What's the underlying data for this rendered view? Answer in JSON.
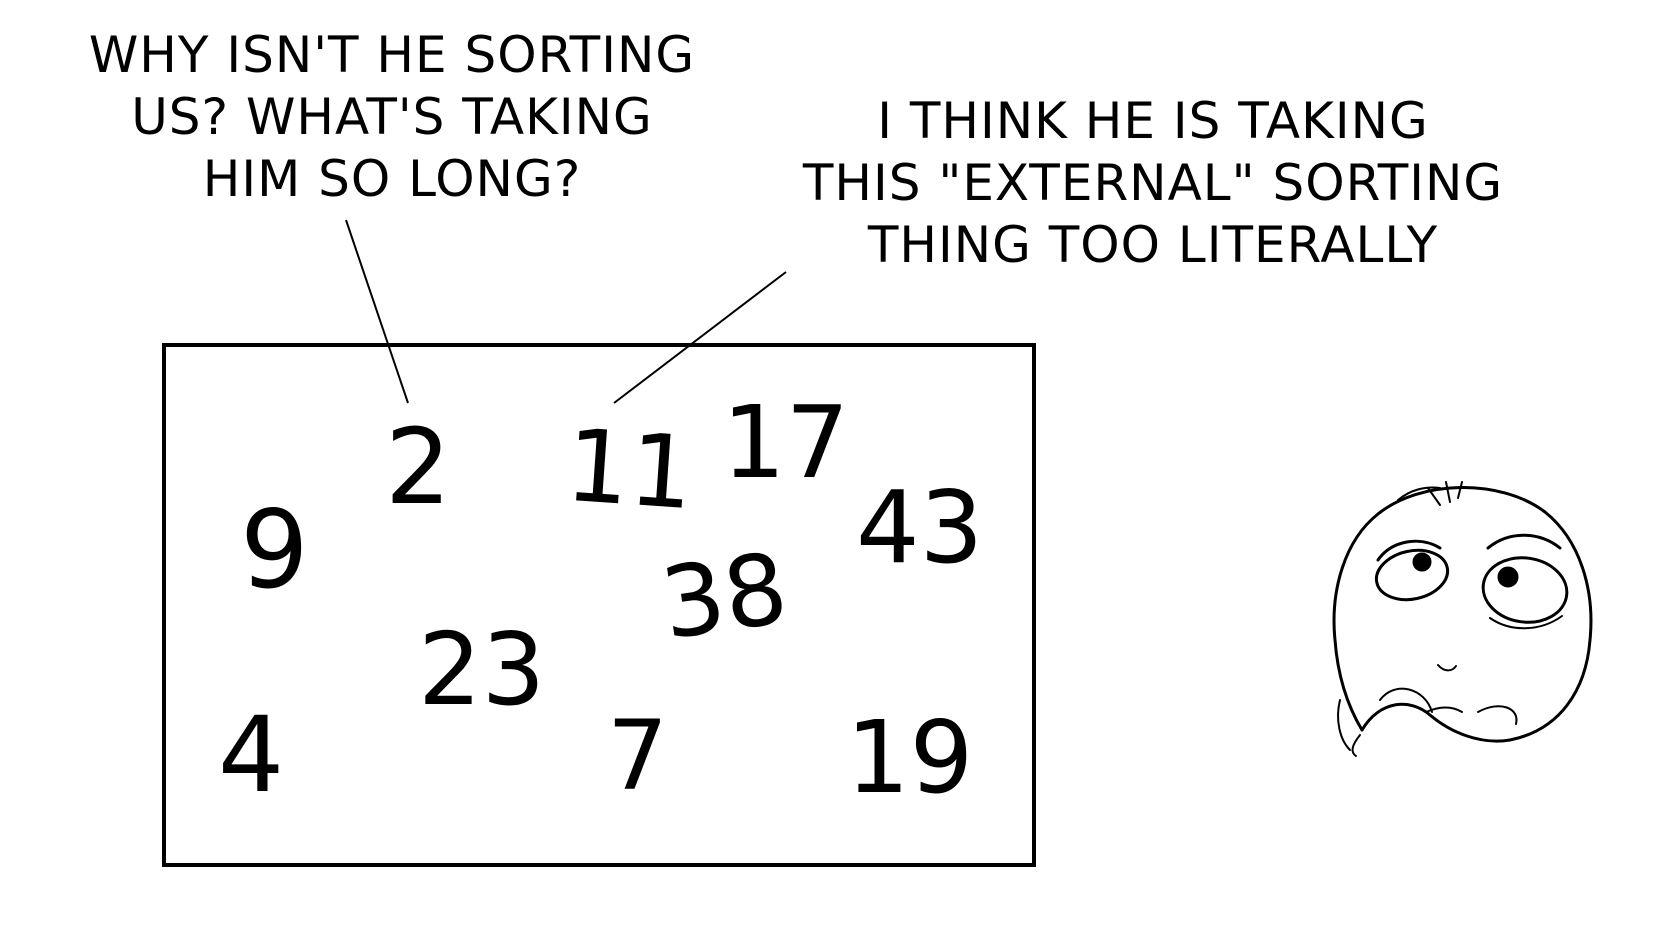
{
  "speech_left": {
    "lines": [
      "WHY ISN'T HE SORTING",
      "US? WHAT'S TAKING",
      "HIM SO LONG?"
    ]
  },
  "speech_right": {
    "lines": [
      "I THINK HE IS TAKING",
      "THIS \"EXTERNAL\" SORTING",
      "THING TOO LITERALLY"
    ]
  },
  "numbers": {
    "n2": "2",
    "n11": "11",
    "n17": "17",
    "n9": "9",
    "n43": "43",
    "n38": "38",
    "n23": "23",
    "n4": "4",
    "n7": "7",
    "n19": "19"
  },
  "face": {
    "icon": "thinking-rage-face-icon"
  }
}
